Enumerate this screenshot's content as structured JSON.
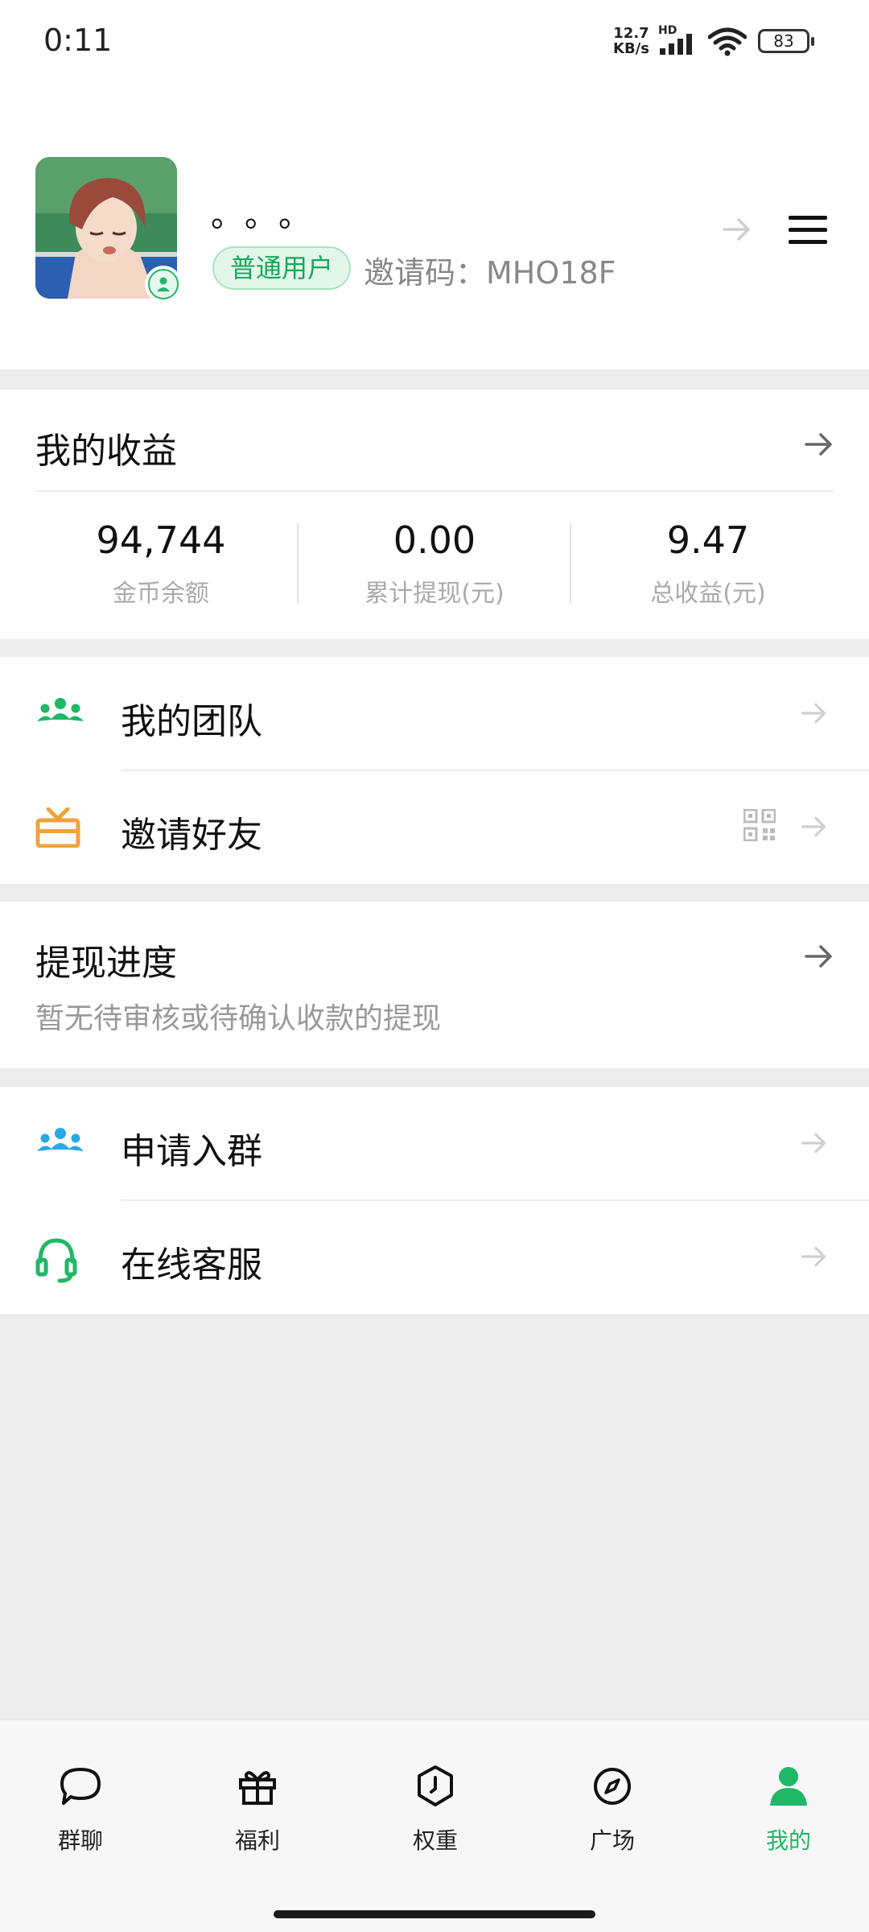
{
  "status_bar": {
    "time": "0:11",
    "net_speed_value": "12.7",
    "net_speed_unit": "KB/s",
    "network_badge": "HD",
    "battery": "83",
    "icons": [
      "signal-icon",
      "wifi-icon",
      "battery-icon"
    ]
  },
  "profile": {
    "nickname": "。。。",
    "user_type": "普通用户",
    "invite_code": "邀请码：MHO18F",
    "icons": [
      "avatar",
      "person-badge-icon",
      "arrow-right-icon",
      "menu-icon"
    ]
  },
  "earnings": {
    "title": "我的收益",
    "stats": [
      {
        "value": "94,744",
        "label": "金币余额"
      },
      {
        "value": "0.00",
        "label": "累计提现(元)"
      },
      {
        "value": "9.47",
        "label": "总收益(元)"
      }
    ]
  },
  "menu_group_1": [
    {
      "label": "我的团队",
      "icon": "team-icon"
    },
    {
      "label": "邀请好友",
      "icon": "gift-icon"
    }
  ],
  "withdraw_progress": {
    "title": "提现进度",
    "subtitle": "暂无待审核或待确认收款的提现"
  },
  "menu_group_2": [
    {
      "label": "申请入群",
      "icon": "group-icon"
    },
    {
      "label": "在线客服",
      "icon": "headset-icon"
    }
  ],
  "tabs": [
    {
      "label": "群聊",
      "icon": "chat-bubble-icon"
    },
    {
      "label": "福利",
      "icon": "gift-box-icon"
    },
    {
      "label": "权重",
      "icon": "hexagon-badge-icon"
    },
    {
      "label": "广场",
      "icon": "compass-icon"
    },
    {
      "label": "我的",
      "icon": "person-icon",
      "active": true
    }
  ],
  "colors": {
    "accent_green": "#1fb866",
    "accent_orange": "#f0a23a",
    "accent_blue": "#2aa7e8",
    "background": "#ececec"
  }
}
